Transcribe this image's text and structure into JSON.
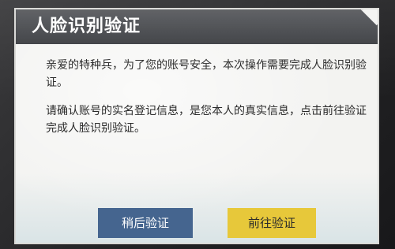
{
  "dialog": {
    "title": "人脸识别验证",
    "paragraph1": "亲爱的特种兵，为了您的账号安全，本次操作需要完成人脸识别验证。",
    "paragraph2": "请确认账号的实名登记信息，是您本人的真实信息，点击前往验证完成人脸识别验证。"
  },
  "buttons": {
    "later_label": "稍后验证",
    "go_label": "前往验证"
  },
  "colors": {
    "header": "#4a4c50",
    "later_button": "#45658f",
    "go_button": "#e7c83a"
  }
}
